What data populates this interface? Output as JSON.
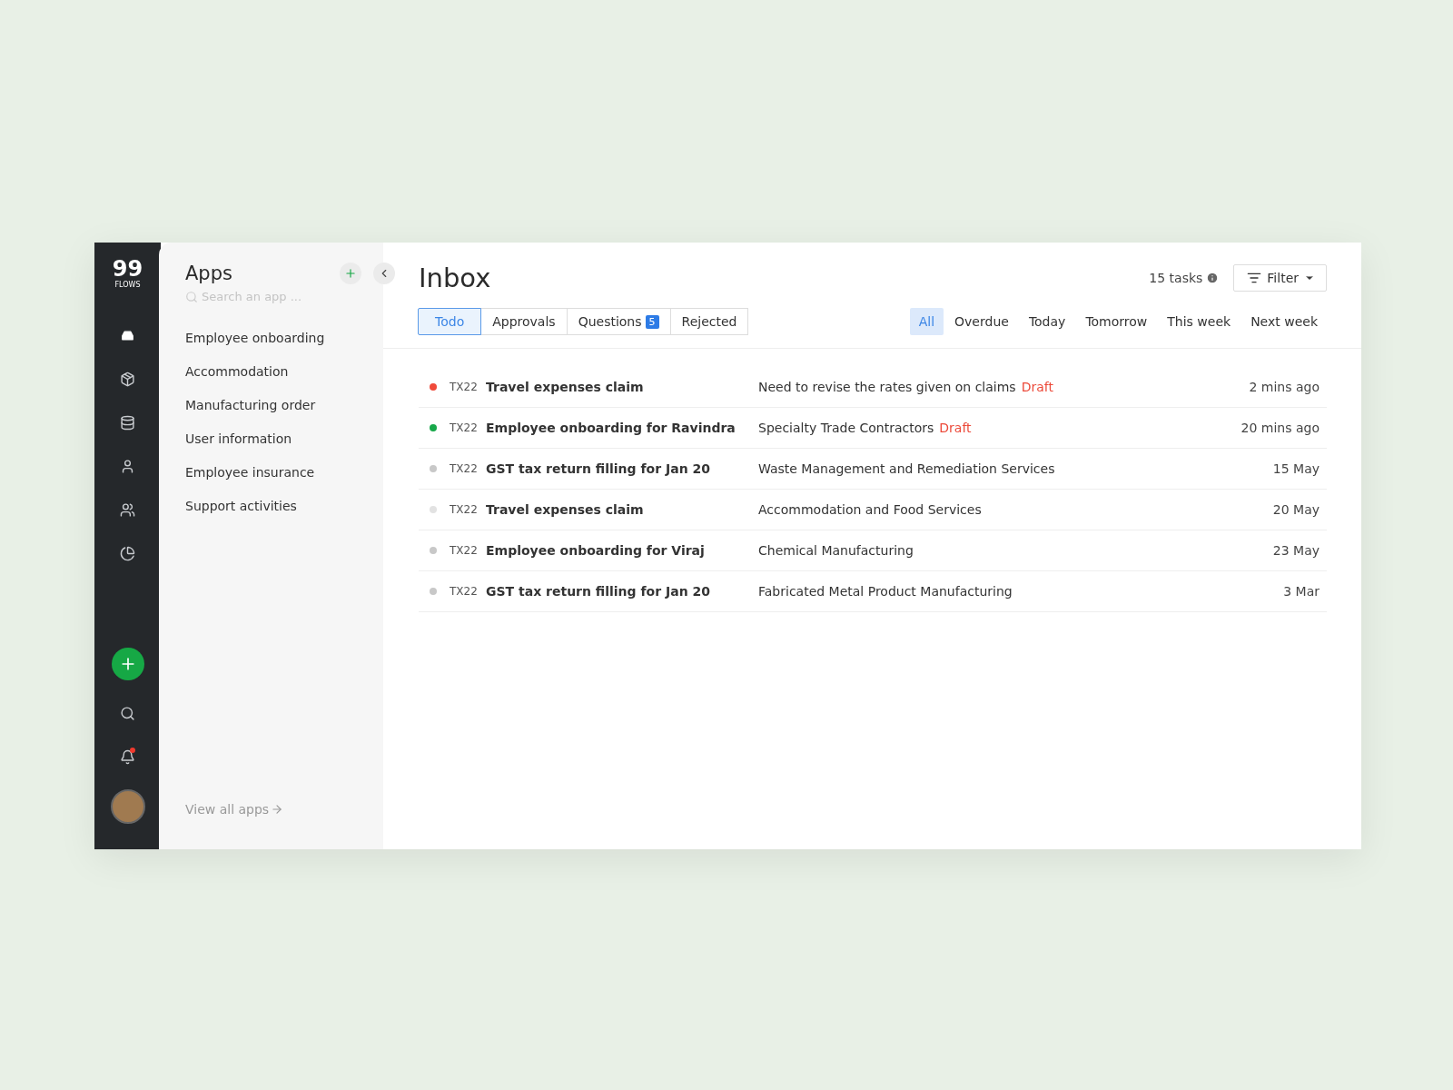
{
  "logo": {
    "number": "99",
    "word": "FLOWS"
  },
  "rail": {
    "items": [
      {
        "selected": true
      },
      {
        "selected": false
      },
      {
        "selected": false
      },
      {
        "selected": false
      },
      {
        "selected": false
      },
      {
        "selected": false
      }
    ],
    "notification": true
  },
  "apps": {
    "title": "Apps",
    "search": {
      "placeholder": "Search an app ..."
    },
    "items": [
      "Employee onboarding",
      "Accommodation",
      "Manufacturing order",
      "User information",
      "Employee insurance",
      "Support activities"
    ],
    "footer_link": "View all apps"
  },
  "inbox": {
    "title": "Inbox",
    "task_count": "15 tasks",
    "filter": "Filter",
    "tabs": [
      {
        "label": "Todo",
        "selected": true
      },
      {
        "label": "Approvals",
        "selected": false
      },
      {
        "label": "Questions",
        "badge": "5",
        "selected": false
      },
      {
        "label": "Rejected",
        "selected": false
      }
    ],
    "periods": [
      {
        "label": "All",
        "selected": true
      },
      {
        "label": "Overdue",
        "selected": false
      },
      {
        "label": "Today",
        "selected": false
      },
      {
        "label": "Tomorrow",
        "selected": false
      },
      {
        "label": "This week",
        "selected": false
      },
      {
        "label": "Next week",
        "selected": false
      }
    ],
    "rows": [
      {
        "color": "#f04a3a",
        "code": "TX22",
        "title": "Travel expenses claim",
        "description": "Need to revise the rates given on claims",
        "tag": "Draft",
        "time": "2 mins ago"
      },
      {
        "color": "#17a84a",
        "code": "TX22",
        "title": "Employee onboarding for Ravindra",
        "description": "Specialty Trade Contractors",
        "tag": "Draft",
        "time": "20 mins ago"
      },
      {
        "color": "#c8c8c8",
        "code": "TX22",
        "title": "GST tax return filling for Jan 20",
        "description": "Waste Management and Remediation Services",
        "time": "15 May"
      },
      {
        "color": "#e2e2e2",
        "code": "TX22",
        "title": "Travel expenses claim",
        "description": "Accommodation and Food Services",
        "time": "20 May"
      },
      {
        "color": "#c8c8c8",
        "code": "TX22",
        "title": "Employee onboarding for Viraj",
        "description": "Chemical Manufacturing",
        "time": "23 May"
      },
      {
        "color": "#c8c8c8",
        "code": "TX22",
        "title": "GST tax return filling for Jan 20",
        "description": "Fabricated Metal Product Manufacturing",
        "time": "3 Mar"
      }
    ]
  }
}
